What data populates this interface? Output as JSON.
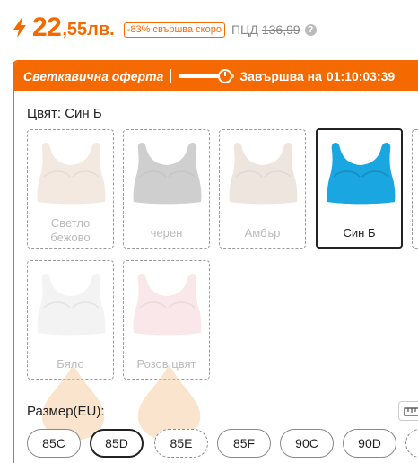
{
  "price": {
    "integer": "22",
    "decimal": ",55лв.",
    "discount_badge": "-83% свършва скоро",
    "rrp_label": "ПЦД",
    "rrp_value": "136,99",
    "help_icon": "?"
  },
  "flash_sale": {
    "title": "Светкавична оферта",
    "progress_percent": 84,
    "ends_label": "Завършва на",
    "timer": "01:10:03:39"
  },
  "color": {
    "label": "Цвят: Син Б",
    "options": [
      {
        "name": "Светло бежово",
        "color": "#e6cdb8",
        "selected": false,
        "low_stock": false
      },
      {
        "name": "черен",
        "color": "#8e8e8e",
        "selected": false,
        "low_stock": false
      },
      {
        "name": "Амбър",
        "color": "#d9c2b5",
        "selected": false,
        "low_stock": false
      },
      {
        "name": "Син Б",
        "color": "#1aa6e0",
        "selected": true,
        "low_stock": false
      },
      {
        "name": "Бяло",
        "color": "#e3e3e3",
        "selected": false,
        "low_stock": true
      },
      {
        "name": "Розов цвят",
        "color": "#f2c8cc",
        "selected": false,
        "low_stock": true
      }
    ]
  },
  "size": {
    "label": "Размер(EU):",
    "options": [
      {
        "label": "85C",
        "selected": false,
        "dashed": false
      },
      {
        "label": "85D",
        "selected": true,
        "dashed": false
      },
      {
        "label": "85E",
        "selected": false,
        "dashed": true
      },
      {
        "label": "85F",
        "selected": false,
        "dashed": false
      },
      {
        "label": "90C",
        "selected": false,
        "dashed": false
      },
      {
        "label": "90D",
        "selected": false,
        "dashed": false
      }
    ]
  },
  "colors": {
    "accent": "#f56a00",
    "low_stock_drop": "#f5c08a"
  }
}
